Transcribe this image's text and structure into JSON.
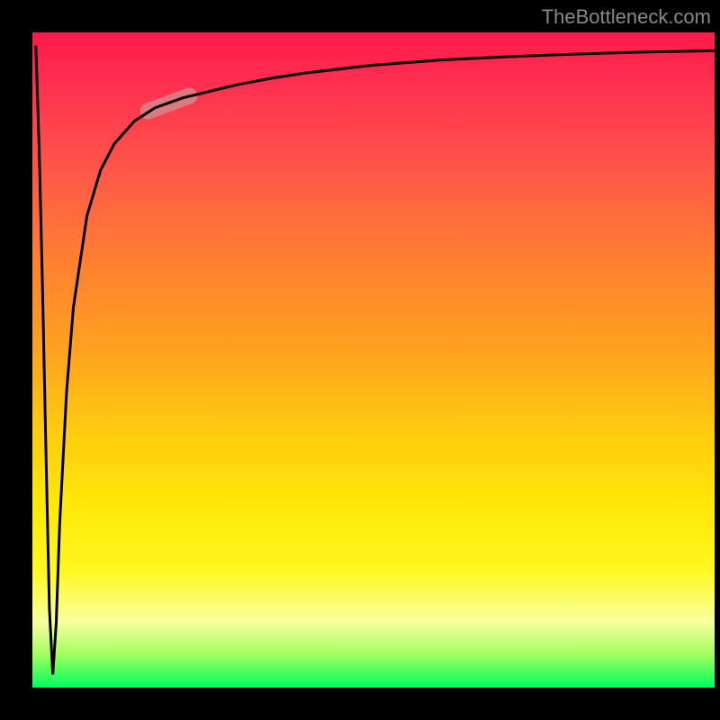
{
  "watermark": "TheBottleneck.com",
  "chart_data": {
    "type": "line",
    "title": "",
    "xlabel": "",
    "ylabel": "",
    "x_range": [
      0,
      100
    ],
    "y_range": [
      0,
      100
    ],
    "description": "Bottleneck curve over a red-to-green vertical gradient. The curve plunges from near-top at x≈0 to the bottom (y≈0) around x≈3, then rises steeply and asymptotically approaches the top as x increases. A short highlighted segment sits on the rising part near x≈17–23.",
    "series": [
      {
        "name": "bottleneck-curve",
        "x": [
          0.5,
          1,
          1.5,
          2,
          2.5,
          3,
          3.5,
          4,
          5,
          6,
          8,
          10,
          12,
          15,
          18,
          22,
          26,
          30,
          35,
          40,
          50,
          60,
          70,
          80,
          90,
          100
        ],
        "y": [
          98,
          82,
          60,
          35,
          12,
          2,
          10,
          25,
          45,
          58,
          72,
          79,
          83,
          86.5,
          88.5,
          90,
          91,
          92,
          93,
          93.8,
          95,
          95.8,
          96.3,
          96.7,
          97,
          97.2
        ]
      }
    ],
    "highlight": {
      "x_start": 17,
      "x_end": 23,
      "y_start": 88,
      "y_end": 90.3
    },
    "gradient_stops": [
      {
        "pos": 0,
        "color": "#ff1a4a"
      },
      {
        "pos": 22,
        "color": "#ff5a48"
      },
      {
        "pos": 48,
        "color": "#ffa020"
      },
      {
        "pos": 72,
        "color": "#ffe808"
      },
      {
        "pos": 95,
        "color": "#a0ff60"
      },
      {
        "pos": 100,
        "color": "#00ff60"
      }
    ]
  }
}
